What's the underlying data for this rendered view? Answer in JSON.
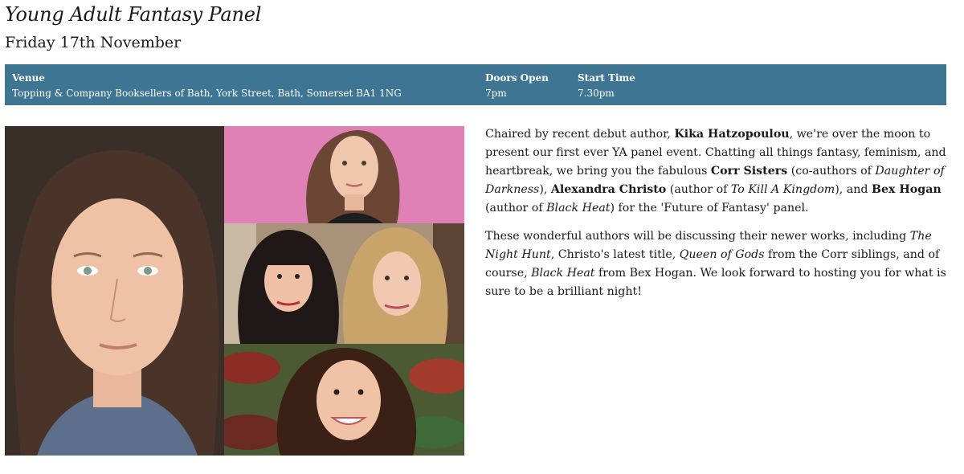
{
  "event": {
    "title": "Young Adult Fantasy Panel",
    "date": "Friday 17th November"
  },
  "info": {
    "venue_label": "Venue",
    "venue_value": "Topping & Company Booksellers of Bath, York Street, Bath, Somerset BA1 1NG",
    "doors_label": "Doors Open",
    "doors_value": "7pm",
    "start_label": "Start Time",
    "start_value": "7.30pm",
    "bar_color": "#3d7593"
  },
  "description": {
    "p1": {
      "t1": "Chaired by recent debut author, ",
      "b1": "Kika Hatzopoulou",
      "t2": ", we're over the moon to present our first ever YA panel event. Chatting all things fantasy, feminism, and heartbreak, we bring you the fabulous ",
      "b2": "Corr Sisters",
      "t3": " (co-authors of ",
      "i1": "Daughter of Darkness",
      "t4": "), ",
      "b3": "Alexandra Christo",
      "t5": " (author of ",
      "i2": "To Kill A Kingdom",
      "t6": "), and ",
      "b4": "Bex Hogan",
      "t7": " (author of ",
      "i3": "Black Heat",
      "t8": ") for the 'Future of Fantasy' panel."
    },
    "p2": {
      "t1": "These wonderful authors will be discussing their newer works, including ",
      "i1": "The Night Hunt",
      "t2": ", Christo's latest title, ",
      "i2": "Queen of Gods",
      "t3": " from the Corr siblings, and of course, ",
      "i3": "Black Heat",
      "t4": " from Bex Hogan. We look forward to hosting you for what is sure to be a brilliant night!"
    }
  }
}
